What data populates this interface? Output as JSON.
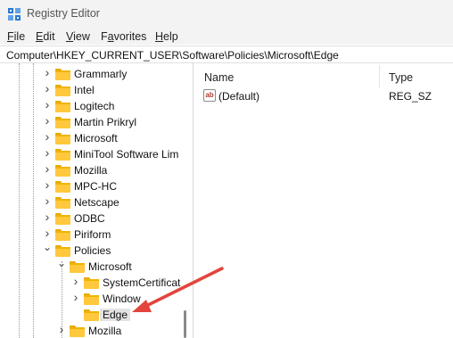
{
  "window": {
    "title": "Registry Editor"
  },
  "menu": {
    "file": {
      "key": "F",
      "rest": "ile"
    },
    "edit": {
      "key": "E",
      "rest": "dit"
    },
    "view": {
      "key": "V",
      "rest": "iew"
    },
    "favorites": {
      "key": "a",
      "before": "F",
      "rest": "vorites"
    },
    "help": {
      "key": "H",
      "rest": "elp"
    }
  },
  "address": {
    "path": "Computer\\HKEY_CURRENT_USER\\Software\\Policies\\Microsoft\\Edge"
  },
  "tree": {
    "items": [
      {
        "label": "Grammarly"
      },
      {
        "label": "Intel"
      },
      {
        "label": "Logitech"
      },
      {
        "label": "Martin Prikryl"
      },
      {
        "label": "Microsoft"
      },
      {
        "label": "MiniTool Software Lim"
      },
      {
        "label": "Mozilla"
      },
      {
        "label": "MPC-HC"
      },
      {
        "label": "Netscape"
      },
      {
        "label": "ODBC"
      },
      {
        "label": "Piriform"
      },
      {
        "label": "Policies"
      },
      {
        "label": "Microsoft"
      },
      {
        "label": "SystemCertificat"
      },
      {
        "label": "Window"
      },
      {
        "label": "Edge"
      },
      {
        "label": "Mozilla"
      }
    ]
  },
  "values_list": {
    "columns": {
      "name": "Name",
      "type": "Type"
    },
    "rows": [
      {
        "name": "(Default)",
        "type": "REG_SZ"
      }
    ]
  },
  "icons": {
    "app": "registry-editor-icon",
    "folder": "folder-icon",
    "string_value": "string-value-icon",
    "annotation": "red-arrow-annotation"
  },
  "colors": {
    "folder": "#ffc83d",
    "annotation_arrow": "#e2453c",
    "selection": "#e3e3e3"
  }
}
